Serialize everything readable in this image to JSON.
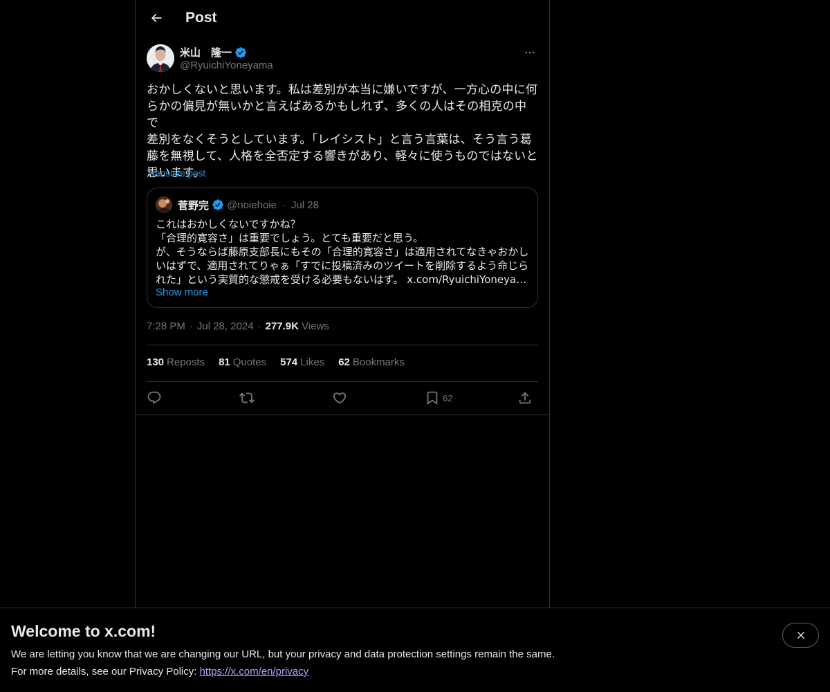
{
  "header": {
    "title": "Post"
  },
  "author": {
    "name": "米山　隆一",
    "handle": "@RyuichiYoneyama"
  },
  "tweet": {
    "lines": [
      "おかしくないと思います。私は差別が本当に嫌いですが、一方心の中に何",
      "らかの偏見が無いかと言えばあるかもしれず、多くの人はその相克の中で",
      "差別をなくそうとしています。「レイシスト」と言う言葉は、そう言う葛",
      "藤を無視して、人格を全否定する響きがあり、軽々に使うものではないと",
      "思います。"
    ],
    "translate_label": "Translate post"
  },
  "quote": {
    "name": "菅野完",
    "handle": "@noiehoie",
    "dot": "·",
    "date": "Jul 28",
    "lines": [
      "これはおかしくないですかね？",
      "「合理的寛容さ」は重要でしょう。とても重要だと思う。",
      "が、そうならば藤原支部長にもその「合理的寛容さ」は適用されてなきゃおかし",
      "いはずで、適用されてりゃぁ「すでに投稿済みのツイートを削除するよう命じら",
      "れた」という実質的な懲戒を受ける必要もないはず。 x.com/RyuichiYoneyam…"
    ],
    "show_more": "Show more"
  },
  "meta": {
    "time": "7:28 PM",
    "dot1": "·",
    "date": "Jul 28, 2024",
    "dot2": "·",
    "views_count": "277.9K",
    "views_label": "Views"
  },
  "stats": [
    {
      "count": "130",
      "label": "Reposts"
    },
    {
      "count": "81",
      "label": "Quotes"
    },
    {
      "count": "574",
      "label": "Likes"
    },
    {
      "count": "62",
      "label": "Bookmarks"
    }
  ],
  "actions": {
    "reply_icon": "reply-icon",
    "repost_icon": "repost-icon",
    "like_icon": "heart-icon",
    "bookmark_icon": "bookmark-icon",
    "bookmark_count": "62",
    "share_icon": "share-icon"
  },
  "banner": {
    "title": "Welcome to x.com!",
    "line1": "We are letting you know that we are changing our URL, but your privacy and data protection settings remain the same.",
    "line2_prefix": "For more details, see our Privacy Policy: ",
    "link": "https://x.com/en/privacy"
  },
  "colors": {
    "background": "#000000",
    "text": "#e7e9ea",
    "muted": "#71767b",
    "accent": "#1d9bf0",
    "border": "#2f3336",
    "verified": "#1d9bf0",
    "link": "#a9a3ff"
  }
}
